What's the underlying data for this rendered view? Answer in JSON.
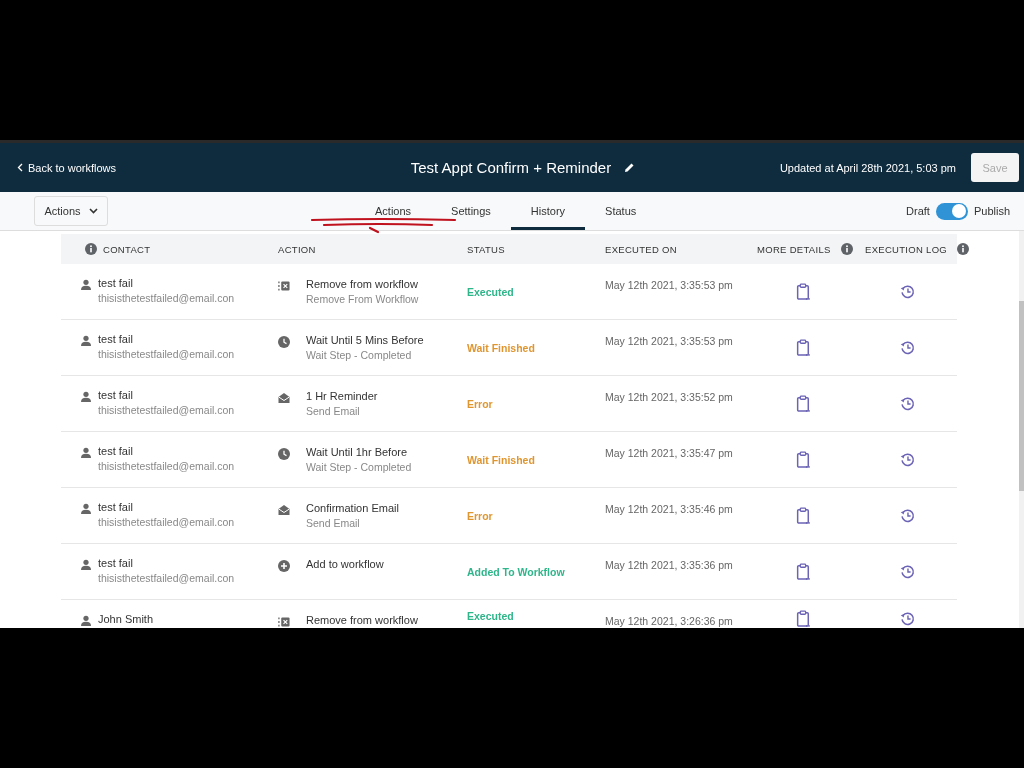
{
  "header": {
    "back_link": "Back to workflows",
    "title": "Test Appt Confirm + Reminder",
    "updated": "Updated at April 28th 2021, 5:03 pm",
    "save_button": {
      "label": "Save",
      "disabled": true
    }
  },
  "toolbar": {
    "actions_menu": "Actions",
    "tabs": [
      {
        "label": "Actions",
        "selected": false
      },
      {
        "label": "Settings",
        "selected": false
      },
      {
        "label": "History",
        "selected": true
      },
      {
        "label": "Status",
        "selected": false
      }
    ],
    "toggle": {
      "off_label": "Draft",
      "on_label": "Publish",
      "on": true
    }
  },
  "table": {
    "columns": [
      {
        "label": "CONTACT",
        "kind": "info_before"
      },
      {
        "label": "ACTION",
        "kind": "plain"
      },
      {
        "label": "STATUS",
        "kind": "plain"
      },
      {
        "label": "EXECUTED ON",
        "kind": "plain"
      },
      {
        "label": "MORE DETAILS",
        "kind": "info_after"
      },
      {
        "label": "EXECUTION LOG",
        "kind": "info_after"
      }
    ],
    "rows": [
      {
        "name": "test fail",
        "email": "thisisthetestfailed@email.con",
        "action": {
          "kind": "remove",
          "title": "Remove from workflow",
          "subtitle": "Remove From Workflow"
        },
        "status": {
          "kind": "success",
          "label": "Executed"
        },
        "executed_on": "May 12th 2021, 3:35:53 pm"
      },
      {
        "name": "test fail",
        "email": "thisisthetestfailed@email.con",
        "action": {
          "kind": "wait",
          "title": "Wait Until 5 Mins Before",
          "subtitle": "Wait Step - Completed"
        },
        "status": {
          "kind": "warning",
          "label": "Wait Finished"
        },
        "executed_on": "May 12th 2021, 3:35:53 pm"
      },
      {
        "name": "test fail",
        "email": "thisisthetestfailed@email.con",
        "action": {
          "kind": "email",
          "title": "1 Hr Reminder",
          "subtitle": "Send Email"
        },
        "status": {
          "kind": "warning",
          "label": "Error"
        },
        "executed_on": "May 12th 2021, 3:35:52 pm"
      },
      {
        "name": "test fail",
        "email": "thisisthetestfailed@email.con",
        "action": {
          "kind": "wait",
          "title": "Wait Until 1hr Before",
          "subtitle": "Wait Step - Completed"
        },
        "status": {
          "kind": "warning",
          "label": "Wait Finished"
        },
        "executed_on": "May 12th 2021, 3:35:47 pm"
      },
      {
        "name": "test fail",
        "email": "thisisthetestfailed@email.con",
        "action": {
          "kind": "email",
          "title": "Confirmation Email",
          "subtitle": "Send Email"
        },
        "status": {
          "kind": "warning",
          "label": "Error"
        },
        "executed_on": "May 12th 2021, 3:35:46 pm"
      },
      {
        "name": "test fail",
        "email": "thisisthetestfailed@email.con",
        "action": {
          "kind": "add",
          "title": "Add to workflow"
        },
        "status": {
          "kind": "success",
          "label": "Added To Workflow"
        },
        "executed_on": "May 12th 2021, 3:35:36 pm"
      },
      {
        "name": "John Smith",
        "action": {
          "kind": "remove",
          "title": "Remove from workflow"
        },
        "status": {
          "kind": "success",
          "label": "Executed"
        },
        "executed_on": "May 12th 2021, 3:26:36 pm"
      }
    ]
  }
}
